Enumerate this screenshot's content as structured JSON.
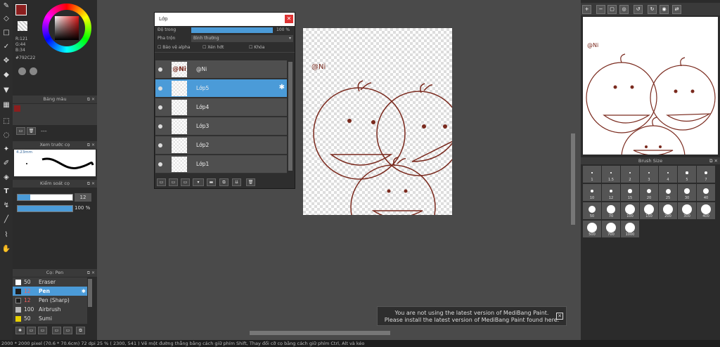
{
  "colors": {
    "primary": "#8b1e1e",
    "accent": "#4b9bd8"
  },
  "color_panel": {
    "r": "R:121",
    "g": "G:44",
    "b": "B:34",
    "hex": "#792C22"
  },
  "palette_panel": {
    "title": "Bảng màu",
    "dash": "---"
  },
  "brush_preview": {
    "title": "Xem trước cọ",
    "size": "4.23mm"
  },
  "control": {
    "title": "Kiểm soát cọ",
    "size_val": "12",
    "opacity_val": "100 %"
  },
  "brush_panel": {
    "title": "Cọ: Pen",
    "items": [
      {
        "size": "50",
        "name": "Eraser",
        "color": "#ffffff"
      },
      {
        "size": "12",
        "name": "Pen",
        "color": "#1e1e1e"
      },
      {
        "size": "12",
        "name": "Pen (Sharp)",
        "color": "#1e1e1e"
      },
      {
        "size": "100",
        "name": "Airbrush",
        "color": "#bbbbbb"
      },
      {
        "size": "50",
        "name": "Sumi",
        "color": "#e8d000"
      }
    ]
  },
  "layer_window": {
    "title": "Lớp",
    "opacity_label": "Độ trong",
    "opacity_val": "100 %",
    "blend_label": "Pha trộn",
    "blend_val": "Bình thường",
    "opt_alpha": "Bảo vệ alpha",
    "opt_clip": "Xén hớt",
    "opt_lock": "Khóa",
    "layers": [
      {
        "name": "@Ni",
        "thumb": "@Ni"
      },
      {
        "name": "Lớp5",
        "thumb": ""
      },
      {
        "name": "Lớp4",
        "thumb": ""
      },
      {
        "name": "Lớp3",
        "thumb": ""
      },
      {
        "name": "Lớp2",
        "thumb": ""
      },
      {
        "name": "Lớp1",
        "thumb": ""
      }
    ]
  },
  "canvas_text": "@Ni",
  "preview_text": "@Ni",
  "brush_size": {
    "title": "Brush Size",
    "sizes": [
      "1",
      "1.5",
      "2",
      "3",
      "4",
      "5",
      "7",
      "10",
      "12",
      "15",
      "20",
      "25",
      "30",
      "40",
      "50",
      "70",
      "100",
      "150",
      "200",
      "300",
      "400",
      "500",
      "700",
      "1000"
    ]
  },
  "notice": {
    "line1": "You are not using the latest version of MediBang Paint.",
    "line2": "Please install the latest version of MediBang Paint found here."
  },
  "status": "2000 * 2000 pixel   (70.6 * 70.6cm)   72 dpi   25 %   ( 2300, 541 )   Vẽ một đường thẳng bằng cách giữ phím Shift, Thay đổi cỡ cọ bằng cách giữ phím Ctrl, Alt và kéo"
}
